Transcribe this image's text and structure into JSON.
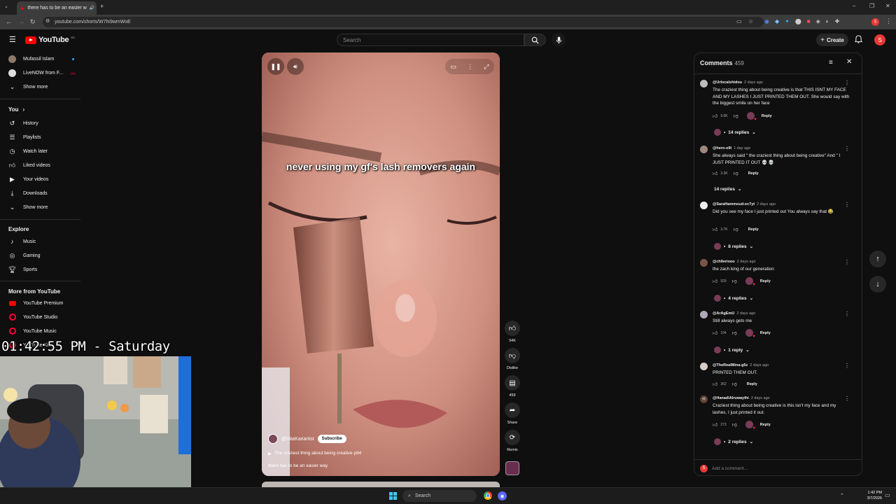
{
  "browser": {
    "tab_title": "there has to be an easier w",
    "url": "youtube.com/shorts/W7hi9wmWoE"
  },
  "header": {
    "logo_text": "YouTube",
    "country_code": "BD",
    "search_placeholder": "Search",
    "create_label": "Create",
    "avatar_letter": "S"
  },
  "sidebar": {
    "subscriptions": [
      {
        "label": "Mufassil Islam"
      },
      {
        "label": "LiveNOW from F..."
      }
    ],
    "show_more_1": "Show more",
    "you_header": "You",
    "you_items": [
      {
        "label": "History",
        "icon": "history-icon"
      },
      {
        "label": "Playlists",
        "icon": "playlist-icon"
      },
      {
        "label": "Watch later",
        "icon": "watch-later-icon"
      },
      {
        "label": "Liked videos",
        "icon": "like-icon"
      },
      {
        "label": "Your videos",
        "icon": "video-icon"
      },
      {
        "label": "Downloads",
        "icon": "download-icon"
      }
    ],
    "show_more_2": "Show more",
    "explore_header": "Explore",
    "explore_items": [
      {
        "label": "Music",
        "icon": "music-icon"
      },
      {
        "label": "Gaming",
        "icon": "gaming-icon"
      },
      {
        "label": "Sports",
        "icon": "trophy-icon"
      }
    ],
    "more_header": "More from YouTube",
    "more_items": [
      {
        "label": "YouTube Premium"
      },
      {
        "label": "YouTube Studio"
      },
      {
        "label": "YouTube Music"
      },
      {
        "label": "YouTube Kids"
      }
    ]
  },
  "video": {
    "caption": "never using my gf's lash removers again",
    "channel": "@VitaKariartist",
    "subscribe_label": "Subscribe",
    "music": "The craziest thing about being creative p94",
    "title": "there has to be an easier way"
  },
  "actions": {
    "likes": "94K",
    "dislike": "Dislike",
    "comments": "459",
    "share": "Share",
    "remix": "Remix"
  },
  "comments": {
    "title": "Comments",
    "count": "459",
    "add_placeholder": "Add a comment...",
    "add_avatar": "S",
    "items": [
      {
        "user": "@Urlocalshidou",
        "time": "2 days ago",
        "text": "The craziest thing about being creative is that THIS ISNT MY FACE AND MY LASHES I JUST PRINTED THEM OUT. She would say with the biggest smile on her face",
        "likes": "9.6K",
        "reply": "Reply",
        "replies": "14 replies"
      },
      {
        "user": "@hero-o9i",
        "time": "1 day ago",
        "text": "She always said \" the craziest thing about being creative\" And \" I JUST PRINTED IT OUT 💀 💀",
        "likes": "3.3K",
        "reply": "Reply",
        "replies": "14 replies"
      },
      {
        "user": "@SaraHammoud-ec7yt",
        "time": "2 days ago",
        "text": "Did you see my face I just printed out You always say that 😂",
        "likes": "3.7K",
        "reply": "Reply",
        "replies": "8 replies"
      },
      {
        "user": "@ch9eriooo",
        "time": "2 days ago",
        "text": "the zach king of our generation",
        "likes": "929",
        "reply": "Reply",
        "replies": "4 replies"
      },
      {
        "user": "@ArAgEmU",
        "time": "2 days ago",
        "text": "Still always gets me",
        "likes": "104",
        "reply": "Reply",
        "replies": "1 reply"
      },
      {
        "user": "@TheRealMina-g5z",
        "time": "2 days ago",
        "text": "PRINTED THEM OUT.",
        "likes": "362",
        "reply": "Reply",
        "replies": ""
      },
      {
        "user": "@HanadiAlruwaythi",
        "time": "2 days ago",
        "text": "Craziest thing about being creative is this isn't my face and my lashes. I just printed it out.",
        "likes": "273",
        "reply": "Reply",
        "replies": "2 replies"
      }
    ]
  },
  "overlay": {
    "clock": "01:42:55 PM - Saturday"
  },
  "taskbar": {
    "search": "Search",
    "time": "1:42 PM",
    "date": "3/7/2026"
  }
}
